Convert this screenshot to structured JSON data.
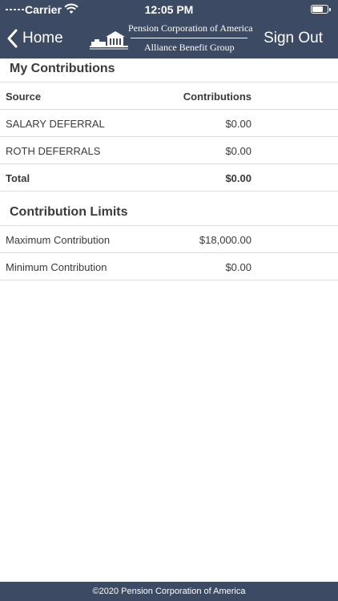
{
  "status_bar": {
    "carrier": "Carrier",
    "time": "12:05 PM"
  },
  "nav": {
    "back_label": "Home",
    "logo_line1": "Pension Corporation of America",
    "logo_line2": "Alliance Benefit Group",
    "sign_out_label": "Sign Out"
  },
  "contributions": {
    "title": "My Contributions",
    "headers": {
      "source": "Source",
      "contributions": "Contributions"
    },
    "rows": [
      {
        "source": "SALARY DEFERRAL",
        "amount": "$0.00"
      },
      {
        "source": "ROTH DEFERRALS",
        "amount": "$0.00"
      }
    ],
    "total": {
      "label": "Total",
      "amount": "$0.00"
    }
  },
  "limits": {
    "title": "Contribution Limits",
    "rows": [
      {
        "label": "Maximum Contribution",
        "amount": "$18,000.00"
      },
      {
        "label": "Minimum Contribution",
        "amount": "$0.00"
      }
    ]
  },
  "footer": {
    "text": "©2020 Pension Corporation of America"
  },
  "colors": {
    "header_bg": "#3d4a63",
    "text": "#3a3a3a",
    "divider": "#dcdcdc"
  }
}
